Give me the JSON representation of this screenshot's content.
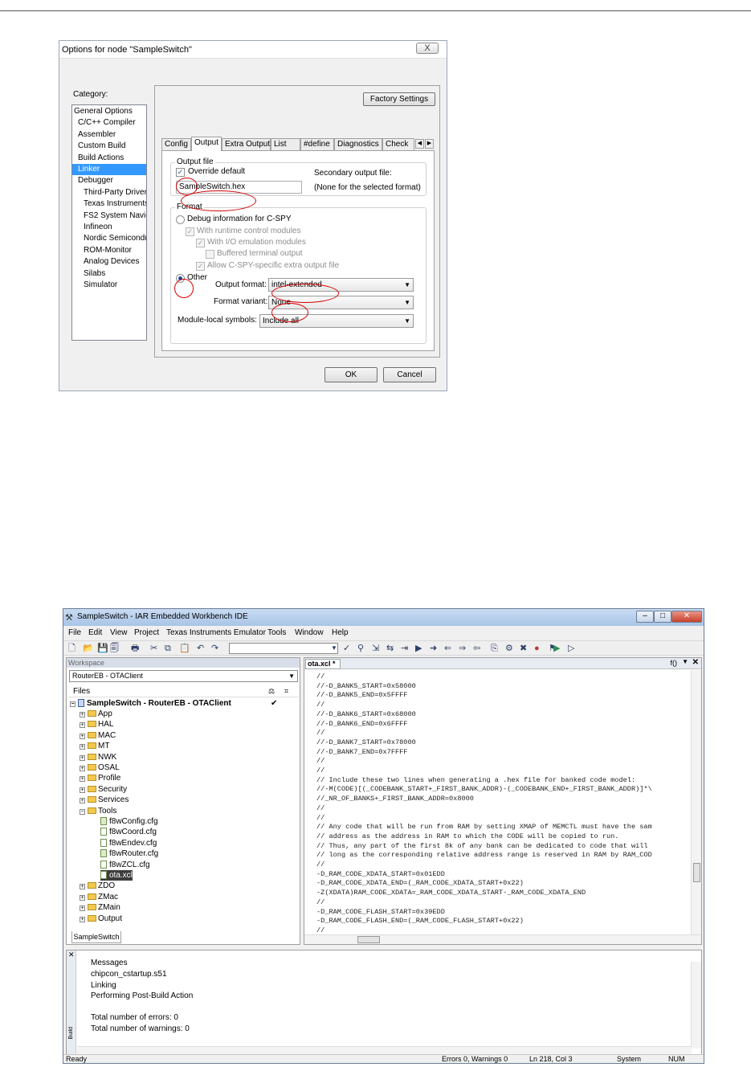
{
  "dialog": {
    "title": "Options for node \"SampleSwitch\"",
    "close_glyph": "X",
    "category_label": "Category:",
    "categories": [
      {
        "label": "General Options",
        "indent": 0
      },
      {
        "label": "C/C++ Compiler",
        "indent": 1
      },
      {
        "label": "Assembler",
        "indent": 1
      },
      {
        "label": "Custom Build",
        "indent": 1
      },
      {
        "label": "Build Actions",
        "indent": 1
      },
      {
        "label": "Linker",
        "indent": 1,
        "selected": true
      },
      {
        "label": "Debugger",
        "indent": 1
      },
      {
        "label": "Third-Party Driver",
        "indent": 2
      },
      {
        "label": "Texas Instruments",
        "indent": 2
      },
      {
        "label": "FS2 System Navig",
        "indent": 2
      },
      {
        "label": "Infineon",
        "indent": 2
      },
      {
        "label": "Nordic Semiconduc",
        "indent": 2
      },
      {
        "label": "ROM-Monitor",
        "indent": 2
      },
      {
        "label": "Analog Devices",
        "indent": 2
      },
      {
        "label": "Silabs",
        "indent": 2
      },
      {
        "label": "Simulator",
        "indent": 2
      }
    ],
    "factory_settings_label": "Factory Settings",
    "tabs": [
      "Config",
      "Output",
      "Extra Output",
      "List",
      "#define",
      "Diagnostics",
      "Check"
    ],
    "active_tab": "Output",
    "output_file_group": "Output file",
    "override_default": {
      "label": "Override default",
      "checked": true
    },
    "output_filename": "SampleSwitch.hex",
    "secondary_label": "Secondary output file:",
    "secondary_value": "(None for the selected format)",
    "format_group": "Format",
    "debug_info": {
      "label": "Debug information for C-SPY",
      "selected": false
    },
    "runtime_control": {
      "label": "With runtime control modules",
      "checked": true
    },
    "io_emulation": {
      "label": "With I/O emulation modules",
      "checked": true
    },
    "buffered_output": {
      "label": "Buffered terminal output",
      "checked": false
    },
    "allow_cspy": {
      "label": "Allow C-SPY-specific extra output file",
      "checked": true
    },
    "other": {
      "label": "Other",
      "selected": true
    },
    "output_format_label": "Output format:",
    "output_format_value": "intel-extended",
    "format_variant_label": "Format variant:",
    "format_variant_value": "None",
    "module_local_label": "Module-local symbols:",
    "module_local_value": "Include all",
    "ok_label": "OK",
    "cancel_label": "Cancel"
  },
  "ide": {
    "title": "SampleSwitch - IAR Embedded Workbench IDE",
    "menu": [
      "File",
      "Edit",
      "View",
      "Project",
      "Texas Instruments Emulator",
      "Tools",
      "Window",
      "Help"
    ],
    "workspace_header": "Workspace",
    "workspace_config": "RouterEB - OTAClient",
    "files_label": "Files",
    "project_root": "SampleSwitch - RouterEB - OTAClient",
    "tree": [
      {
        "label": "App",
        "type": "folder",
        "level": 1
      },
      {
        "label": "HAL",
        "type": "folder",
        "level": 1
      },
      {
        "label": "MAC",
        "type": "folder",
        "level": 1
      },
      {
        "label": "MT",
        "type": "folder",
        "level": 1
      },
      {
        "label": "NWK",
        "type": "folder",
        "level": 1
      },
      {
        "label": "OSAL",
        "type": "folder",
        "level": 1
      },
      {
        "label": "Profile",
        "type": "folder",
        "level": 1
      },
      {
        "label": "Security",
        "type": "folder",
        "level": 1
      },
      {
        "label": "Services",
        "type": "folder",
        "level": 1
      },
      {
        "label": "Tools",
        "type": "folder",
        "level": 1,
        "expanded": true
      },
      {
        "label": "f8wConfig.cfg",
        "type": "file",
        "level": 2,
        "green": true
      },
      {
        "label": "f8wCoord.cfg",
        "type": "file",
        "level": 2
      },
      {
        "label": "f8wEndev.cfg",
        "type": "file",
        "level": 2
      },
      {
        "label": "f8wRouter.cfg",
        "type": "file",
        "level": 2,
        "green": true
      },
      {
        "label": "f8wZCL.cfg",
        "type": "file",
        "level": 2
      },
      {
        "label": "ota.xcl",
        "type": "file",
        "level": 2,
        "selected": true
      },
      {
        "label": "ZDO",
        "type": "folder",
        "level": 1
      },
      {
        "label": "ZMac",
        "type": "folder",
        "level": 1
      },
      {
        "label": "ZMain",
        "type": "folder",
        "level": 1
      },
      {
        "label": "Output",
        "type": "folder",
        "level": 1
      }
    ],
    "workspace_tab": "SampleSwitch",
    "editor_tab": "ota.xcl *",
    "editor_func": "f()",
    "code": [
      "//",
      "//-D_BANK5_START=0x58000",
      "//-D_BANK5_END=0x5FFFF",
      "//",
      "//-D_BANK6_START=0x68000",
      "//-D_BANK6_END=0x6FFFF",
      "//",
      "//-D_BANK7_START=0x78000",
      "//-D_BANK7_END=0x7FFFF",
      "//",
      "//",
      "// Include these two lines when generating a .hex file for banked code model:",
      "//-M(CODE)[(_CODEBANK_START+_FIRST_BANK_ADDR)-(_CODEBANK_END+_FIRST_BANK_ADDR)]*\\",
      "//_NR_OF_BANKS+_FIRST_BANK_ADDR=0x8000",
      "//",
      "//",
      "// Any code that will be run from RAM by setting XMAP of MEMCTL must have the sam",
      "// address as the address in RAM to which the CODE will be copied to run.",
      "// Thus, any part of the first 8k of any bank can be dedicated to code that will",
      "// long as the corresponding relative address range is reserved in RAM by RAM_COD",
      "//",
      "-D_RAM_CODE_XDATA_START=0x01EDD",
      "-D_RAM_CODE_XDATA_END=(_RAM_CODE_XDATA_START+0x22)",
      "-Z(XDATA)RAM_CODE_XDATA=_RAM_CODE_XDATA_START-_RAM_CODE_XDATA_END",
      "//",
      "-D_RAM_CODE_FLASH_START=0x39EDD",
      "-D_RAM_CODE_FLASH_END=(_RAM_CODE_FLASH_START+0x22)",
      "//"
    ],
    "messages_header": "Messages",
    "messages": [
      "chipcon_cstartup.s51",
      "Linking",
      "Performing Post-Build Action",
      "",
      "Total number of errors: 0",
      "Total number of warnings: 0"
    ],
    "messages_side_label": "Build",
    "status": {
      "ready": "Ready",
      "errors": "Errors 0, Warnings 0",
      "position": "Ln 218, Col 3",
      "mode": "System",
      "num": "NUM"
    }
  }
}
